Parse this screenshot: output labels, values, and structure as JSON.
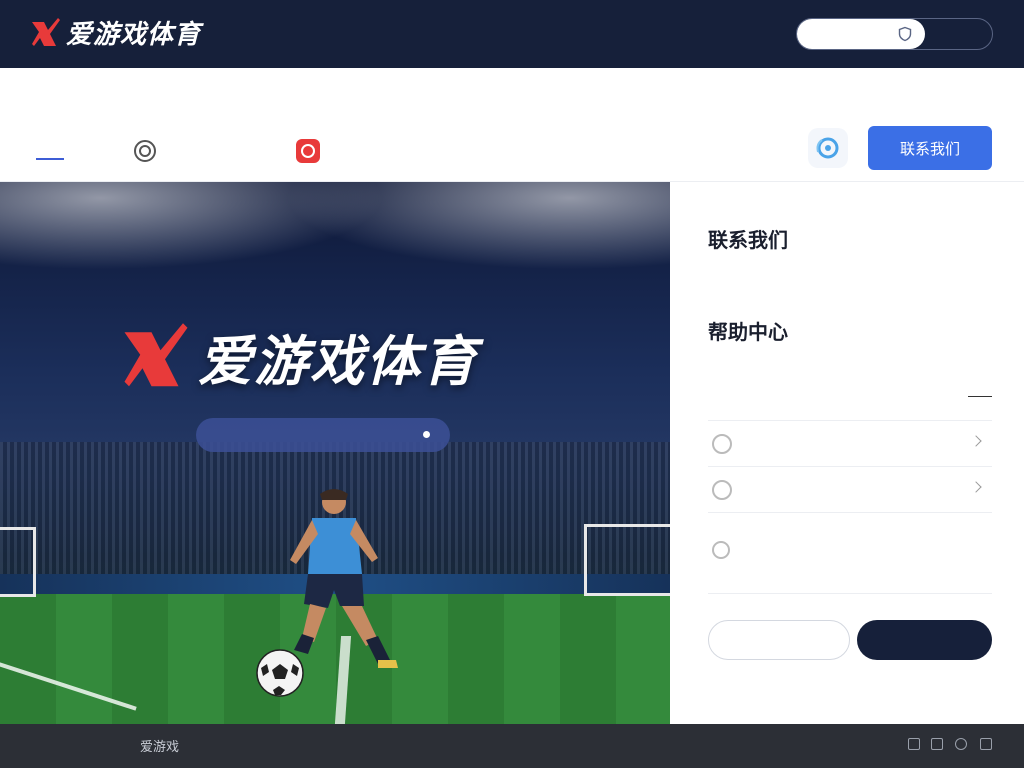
{
  "header": {
    "logo_text": "爱游戏体育",
    "tagline": "",
    "search": {
      "placeholder": ""
    },
    "lang_label": ""
  },
  "nav": {
    "items": [
      {
        "label": "",
        "active": true
      },
      {
        "label": "",
        "icon": "circle-icon"
      }
    ],
    "notice": {
      "icon": "notice-icon",
      "prefix": "",
      "text": ""
    },
    "help_icon": "support-icon",
    "contact_button": "联系我们"
  },
  "hero": {
    "logo_text": "爱游戏体育",
    "pill_text": ""
  },
  "panel": {
    "contact_title": "联系我们",
    "contact_desc": "",
    "help_title": "帮助中心",
    "help_desc": "",
    "phone_label": "",
    "rows": [
      {
        "label": "",
        "value": ""
      },
      {
        "label": "",
        "value": ""
      }
    ],
    "notice_text": "",
    "btn_secondary": "",
    "btn_primary": ""
  },
  "footer": {
    "brand": "",
    "text_left": "",
    "mid_label": "爱游戏",
    "mid_num": "",
    "text_after": "",
    "right_text": ""
  },
  "colors": {
    "header_bg": "#16203a",
    "brand_red": "#e83a3a",
    "primary_blue": "#3b6fe6",
    "footer_bg": "#2c2f36"
  }
}
